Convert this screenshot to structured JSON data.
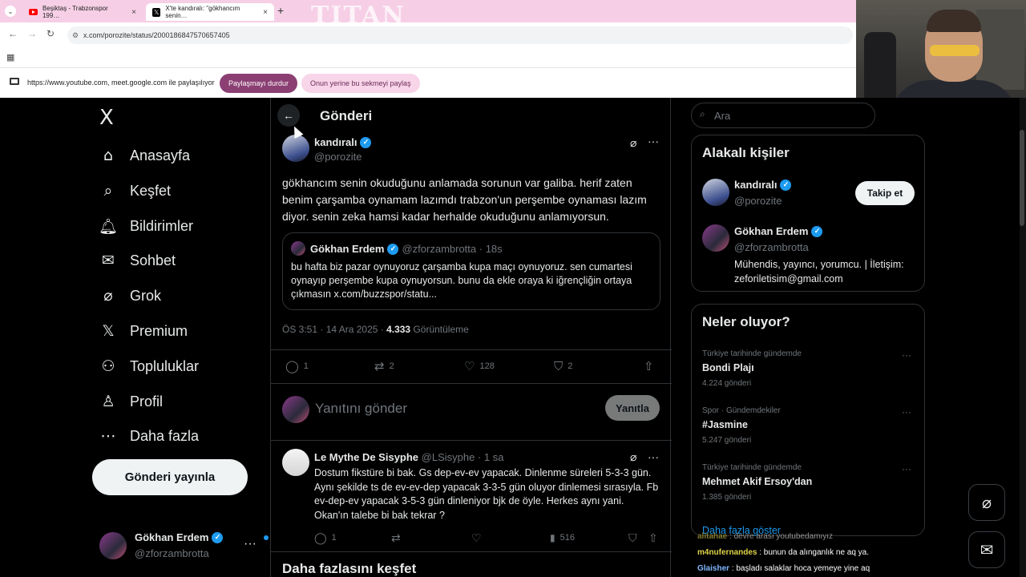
{
  "browser": {
    "tabs": [
      {
        "title": "Beşiktaş - Trabzonspor 199…"
      },
      {
        "title": "X'te kandıralı: \"gökhancım senin…"
      }
    ],
    "watermark": "TITAN",
    "url": "x.com/porozite/status/2000186847570657405",
    "share_text": "https://www.youtube.com, meet.google.com ile paylaşılıyor",
    "stop_share": "Paylaşmayı durdur",
    "share_instead": "Onun yerine bu sekmeyi paylaş"
  },
  "sidebar": {
    "logo": "X",
    "items": [
      {
        "label": "Anasayfa",
        "icon": "home-icon"
      },
      {
        "label": "Keşfet",
        "icon": "search-icon"
      },
      {
        "label": "Bildirimler",
        "icon": "bell-icon"
      },
      {
        "label": "Sohbet",
        "icon": "mail-icon"
      },
      {
        "label": "Grok",
        "icon": "grok-icon"
      },
      {
        "label": "Premium",
        "icon": "x-icon"
      },
      {
        "label": "Topluluklar",
        "icon": "people-icon"
      },
      {
        "label": "Profil",
        "icon": "person-icon"
      },
      {
        "label": "Daha fazla",
        "icon": "more-circle-icon"
      }
    ],
    "post_button": "Gönderi yayınla",
    "me": {
      "name": "Gökhan Erdem",
      "handle": "@zforzambrotta"
    }
  },
  "main": {
    "title": "Gönderi",
    "post": {
      "name": "kandıralı",
      "handle": "@porozite",
      "text": "gökhancım senin okuduğunu anlamada sorunun var galiba. herif zaten benim çarşamba oynamam lazımdı trabzon'un perşembe oynaması lazım diyor. senin zeka hamsi kadar herhalde okuduğunu anlamıyorsun.",
      "quote": {
        "name": "Gökhan Erdem",
        "meta": "@zforzambrotta · 18s",
        "text": "bu hafta biz pazar oynuyoruz çarşamba kupa maçı oynuyoruz. sen cumartesi oynayıp perşembe kupa oynuyorsun. bunu da ekle oraya ki iğrençliğin ortaya çıkmasın x.com/buzzspor/statu..."
      },
      "time": "ÖS 3:51 · 14 Ara 2025 · ",
      "views": "4.333",
      "views_label": " Görüntüleme",
      "replies": "1",
      "reposts": "2",
      "likes": "128",
      "bookmarks": "2"
    },
    "reply_placeholder": "Yanıtını gönder",
    "reply_button": "Yanıtla",
    "reply": {
      "name": "Le Mythe De Sisyphe",
      "meta": "@LSisyphe · 1 sa",
      "text": "Dostum fikstüre bi bak. Gs dep-ev-ev yapacak. Dinlenme süreleri 5-3-3 gün. Aynı şekilde ts de ev-ev-dep yapacak 3-3-5 gün oluyor dinlemesi sırasıyla. Fb ev-dep-ev yapacak 3-5-3 gün dinleniyor bjk de öyle. Herkes aynı yani. Okan'ın talebe bi bak tekrar ?",
      "replies": "1",
      "views": "516"
    },
    "explore_title": "Daha fazlasını keşfet"
  },
  "right": {
    "search_placeholder": "Ara",
    "people_title": "Alakalı kişiler",
    "people": [
      {
        "name": "kandıralı",
        "handle": "@porozite",
        "follow": "Takip et"
      },
      {
        "name": "Gökhan Erdem",
        "handle": "@zforzambrotta",
        "bio": "Mühendis, yayıncı, yorumcu. | İletişim: zeforiletisim@gmail.com"
      }
    ],
    "trends_title": "Neler oluyor?",
    "trends": [
      {
        "context": "Türkiye tarihinde gündemde",
        "name": "Bondi Plajı",
        "count": "4.224 gönderi"
      },
      {
        "context": "Spor · Gündemdekiler",
        "name": "#Jasmine",
        "count": "5.247 gönderi"
      },
      {
        "context": "Türkiye tarihinde gündemde",
        "name": "Mehmet Akif Ersoy'dan",
        "count": "1.385 gönderi"
      }
    ],
    "show_more": "Daha fazla göster"
  },
  "chat": [
    {
      "user": "alitahae",
      "text": " : devre arası youtubedamıyız"
    },
    {
      "user": "m4nufernandes",
      "text": " : bunun da alınganlık ne aq ya."
    },
    {
      "user": "Glaisher",
      "text": " : başladı salaklar hoca yemeye yine aq"
    }
  ],
  "colors": {
    "accent": "#1d9bf0",
    "share_stop_bg": "#8b3f73",
    "tabbar_bg": "#f6cfe6"
  }
}
